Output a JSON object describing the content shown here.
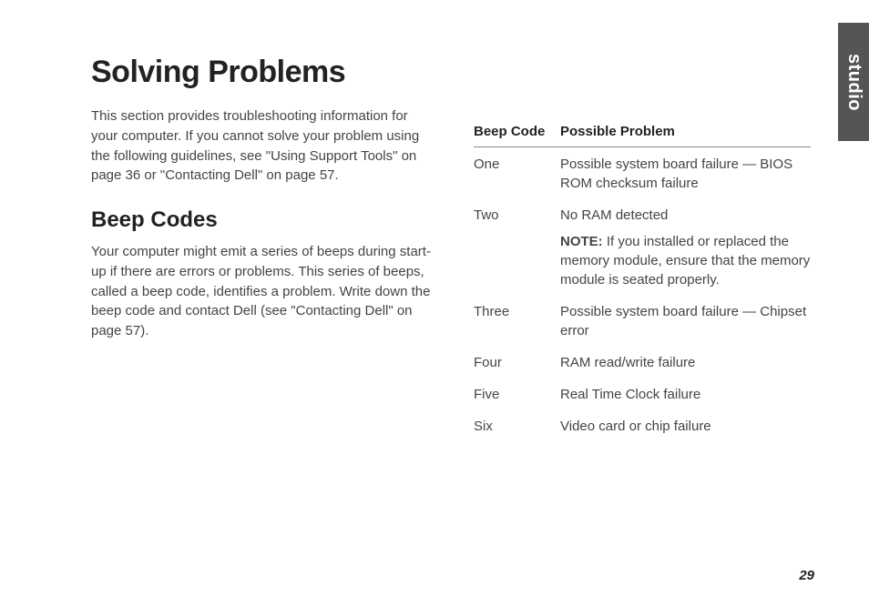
{
  "sideTab": "studio",
  "pageNumber": "29",
  "title": "Solving Problems",
  "intro": "This section provides troubleshooting information for your computer. If you cannot solve your problem using the following guidelines, see \"Using Support Tools\" on page 36 or \"Contacting Dell\" on page 57.",
  "sectionHeading": "Beep Codes",
  "sectionText": "Your computer might emit a series of beeps during start-up if there are errors or problems. This series of beeps, called a beep code, identifies a problem. Write down the beep code and contact Dell (see \"Contacting Dell\" on page 57).",
  "table": {
    "headers": {
      "code": "Beep Code",
      "problem": "Possible Problem"
    },
    "rows": [
      {
        "code": "One",
        "problem": "Possible  system board failure — BIOS ROM checksum failure"
      },
      {
        "code": "Two",
        "problem": "No RAM detected",
        "noteLabel": "NOTE:",
        "noteText": " If you installed or replaced the memory module, ensure that the memory module is seated properly."
      },
      {
        "code": "Three",
        "problem": "Possible system board failure — Chipset error"
      },
      {
        "code": "Four",
        "problem": "RAM read/write failure"
      },
      {
        "code": "Five",
        "problem": "Real Time Clock failure"
      },
      {
        "code": "Six",
        "problem": "Video card or chip failure"
      }
    ]
  }
}
